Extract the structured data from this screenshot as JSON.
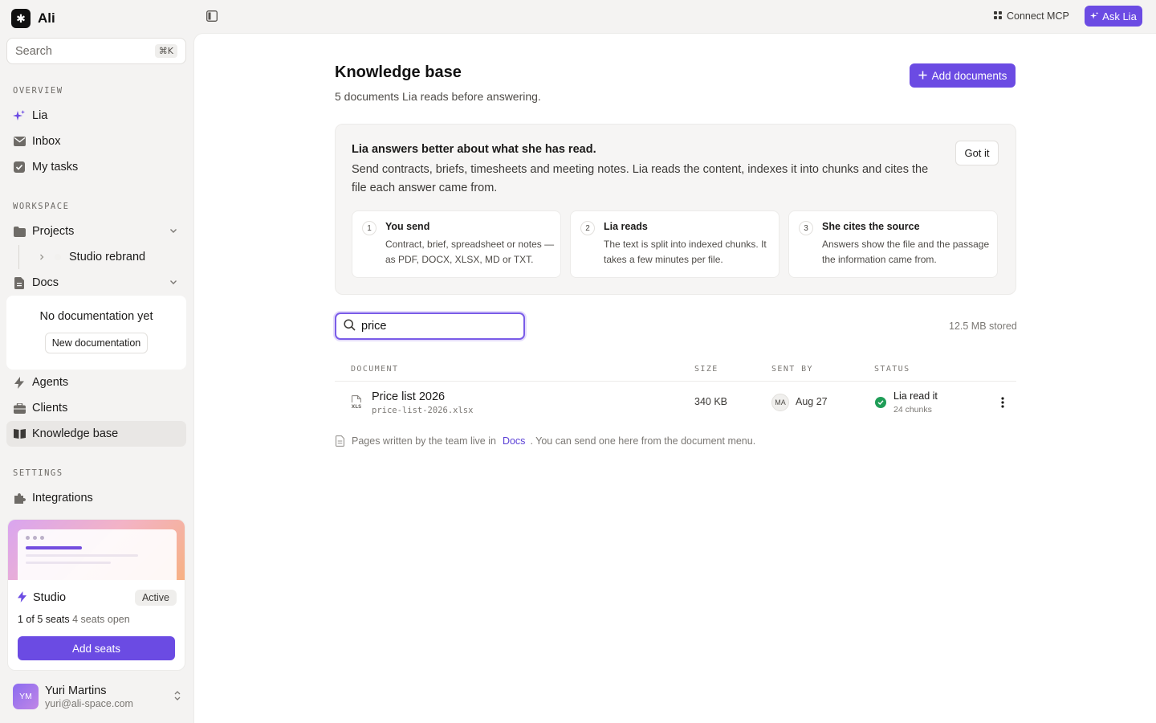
{
  "app": {
    "name": "Ali",
    "logo_glyph": "✱"
  },
  "search": {
    "placeholder": "Search",
    "shortcut": "⌘K"
  },
  "sidebar": {
    "overview_label": "OVERVIEW",
    "overview": [
      {
        "label": "Lia",
        "icon": "sparkle-icon"
      },
      {
        "label": "Inbox",
        "icon": "mail-icon"
      },
      {
        "label": "My tasks",
        "icon": "checkbox-icon"
      }
    ],
    "workspace_label": "WORKSPACE",
    "projects_label": "Projects",
    "project_child": "Studio rebrand",
    "docs_label": "Docs",
    "docs_empty_title": "No documentation yet",
    "docs_empty_button": "New documentation",
    "agents_label": "Agents",
    "clients_label": "Clients",
    "kb_label": "Knowledge base",
    "settings_label": "SETTINGS",
    "integrations_label": "Integrations"
  },
  "plan": {
    "name": "Studio",
    "badge": "Active",
    "seats_used": "1 of 5 seats",
    "seats_open": "4 seats open",
    "button": "Add seats"
  },
  "user": {
    "initials": "YM",
    "name": "Yuri Martins",
    "email": "yuri@ali-space.com"
  },
  "topbar": {
    "connect": "Connect MCP",
    "ask": "Ask Lia"
  },
  "page": {
    "title": "Knowledge base",
    "subtitle": "5 documents Lia reads before answering.",
    "add_button": "Add documents"
  },
  "info": {
    "title": "Lia answers better about what she has read.",
    "body": "Send contracts, briefs, timesheets and meeting notes. Lia reads the content, indexes it into chunks and cites the file each answer came from.",
    "dismiss": "Got it",
    "steps": [
      {
        "num": "1",
        "title": "You send",
        "body": "Contract, brief, spreadsheet or notes — as PDF, DOCX, XLSX, MD or TXT."
      },
      {
        "num": "2",
        "title": "Lia reads",
        "body": "The text is split into indexed chunks. It takes a few minutes per file."
      },
      {
        "num": "3",
        "title": "She cites the source",
        "body": "Answers show the file and the passage the information came from."
      }
    ]
  },
  "filter": {
    "value": "price"
  },
  "storage": "12.5 MB stored",
  "table": {
    "columns": [
      "DOCUMENT",
      "SIZE",
      "SENT BY",
      "STATUS"
    ],
    "rows": [
      {
        "name": "Price list 2026",
        "file": "price-list-2026.xlsx",
        "file_type": "XLS",
        "size": "340 KB",
        "sender": "MA",
        "date": "Aug 27",
        "status": "Lia read it",
        "chunks": "24 chunks"
      }
    ]
  },
  "footer_note": {
    "before": "Pages written by the team live in",
    "link": "Docs",
    "after": ". You can send one here from the document menu."
  },
  "colors": {
    "accent": "#6b4be3",
    "success": "#1f9d57",
    "sidebar_bg": "#f4f3f2"
  }
}
